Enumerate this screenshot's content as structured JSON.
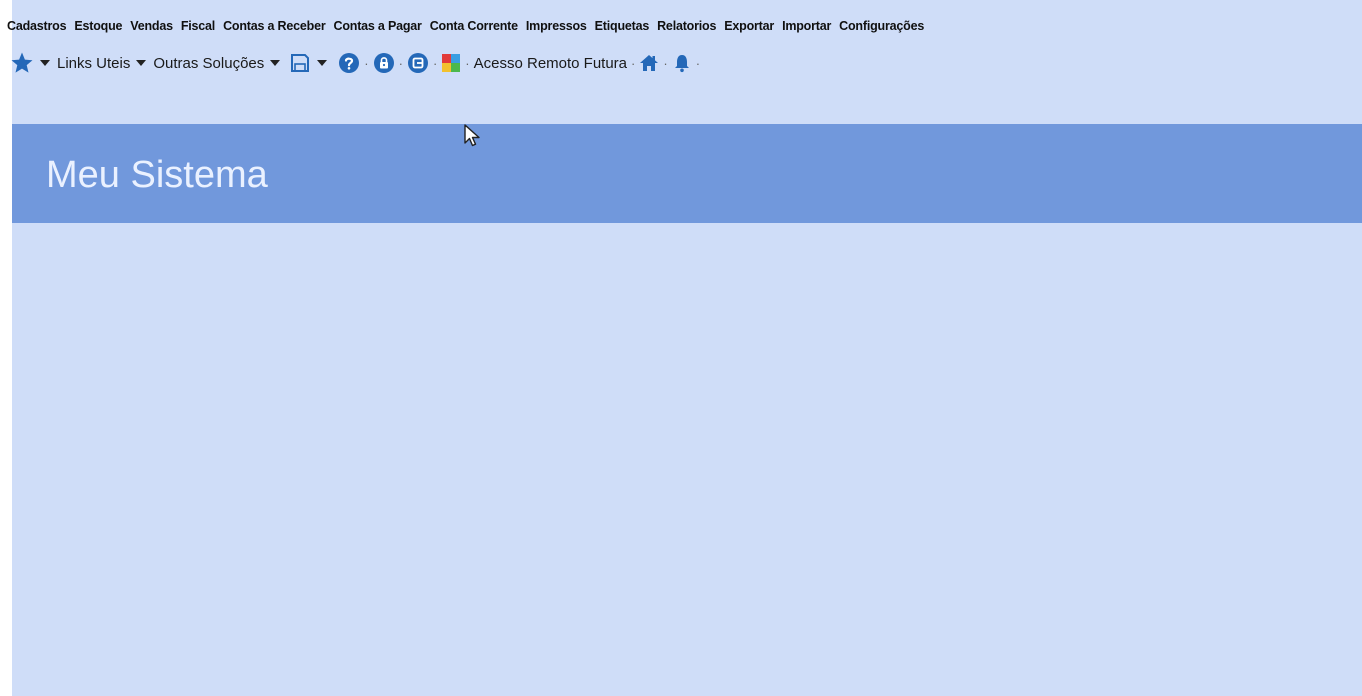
{
  "menu": [
    {
      "label": "Cadastros"
    },
    {
      "label": "Estoque"
    },
    {
      "label": "Vendas"
    },
    {
      "label": "Fiscal"
    },
    {
      "label": "Contas a Receber"
    },
    {
      "label": "Contas a Pagar"
    },
    {
      "label": "Conta Corrente"
    },
    {
      "label": "Impressos"
    },
    {
      "label": "Etiquetas"
    },
    {
      "label": "Relatorios"
    },
    {
      "label": "Exportar"
    },
    {
      "label": "Importar"
    },
    {
      "label": "Configurações"
    }
  ],
  "toolbar": {
    "links_uteis": "Links Uteis",
    "outras_solucoes": "Outras Soluções",
    "acesso_remoto": "Acesso Remoto Futura",
    "separator": "·",
    "icons": [
      "star-icon",
      "save-icon",
      "help-icon",
      "lock-icon",
      "exit-icon",
      "puzzle-icon",
      "home-icon",
      "bell-icon"
    ]
  },
  "header": {
    "title": "Meu Sistema"
  },
  "colors": {
    "background": "#cfddf8",
    "header_band": "#7198dc",
    "icon_blue": "#2468b8"
  }
}
